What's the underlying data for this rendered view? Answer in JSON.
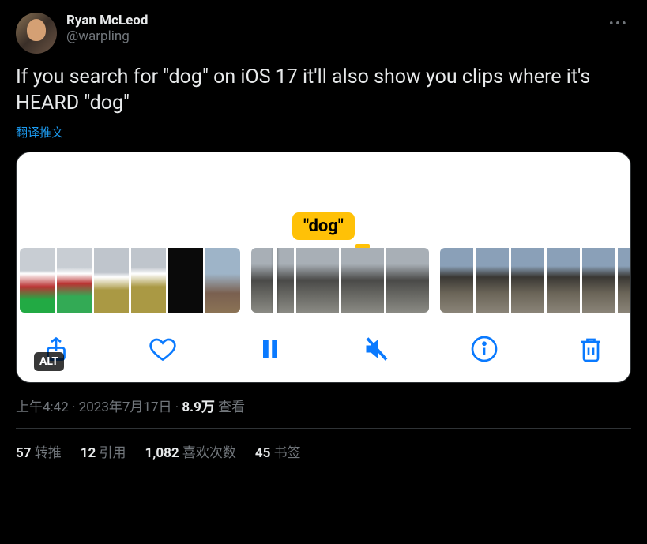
{
  "author": {
    "display_name": "Ryan McLeod",
    "handle": "@warpling"
  },
  "tweet_text": "If you search for \"dog\" on iOS 17 it'll also show you clips where it's HEARD \"dog\"",
  "translate_label": "翻译推文",
  "media": {
    "caption_label": "\"dog\"",
    "alt_badge": "ALT"
  },
  "meta": {
    "time": "上午4:42",
    "date": "2023年7月17日",
    "views_count": "8.9万",
    "views_label": "查看",
    "separator": " · "
  },
  "stats": {
    "retweets": {
      "count": "57",
      "label": "转推"
    },
    "quotes": {
      "count": "12",
      "label": "引用"
    },
    "likes": {
      "count": "1,082",
      "label": "喜欢次数"
    },
    "bookmarks": {
      "count": "45",
      "label": "书签"
    }
  }
}
